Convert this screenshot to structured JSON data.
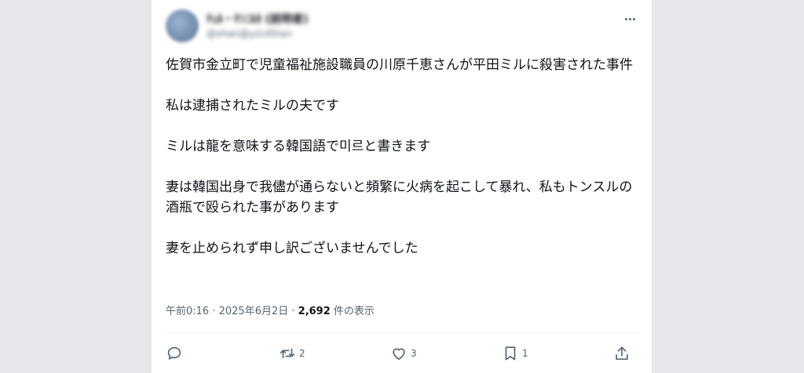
{
  "tweet": {
    "author_name": "ﾁｪﾙ・ﾁﾝﾆﾙｶ (説明者)",
    "author_handle": "@xhan@yzcd5tan",
    "paragraphs": [
      "佐賀市金立町で児童福祉施設職員の川原千恵さんが平田ミルに殺害された事件",
      "私は逮捕されたミルの夫です",
      "ミルは龍を意味する韓国語で미르と書きます",
      "妻は韓国出身で我儘が通らないと頻繁に火病を起こして暴れ、私もトンスルの酒瓶で殴られた事があります",
      "妻を止められず申し訳ございませんでした"
    ],
    "time": "午前0:16",
    "sep1": " · ",
    "date": "2025年6月2日",
    "sep2": " · ",
    "views_count": "2,692",
    "views_label": " 件の表示"
  },
  "actions": {
    "reply": {
      "icon": "reply-icon",
      "count": ""
    },
    "retweet": {
      "icon": "retweet-icon",
      "count": "2"
    },
    "like": {
      "icon": "heart-icon",
      "count": "3"
    },
    "bookmark": {
      "icon": "bookmark-icon",
      "count": "1"
    },
    "share": {
      "icon": "share-icon",
      "count": ""
    }
  },
  "colors": {
    "background": "#e6e7eb",
    "card": "#ffffff",
    "text": "#0f1419",
    "secondary": "#536471"
  }
}
